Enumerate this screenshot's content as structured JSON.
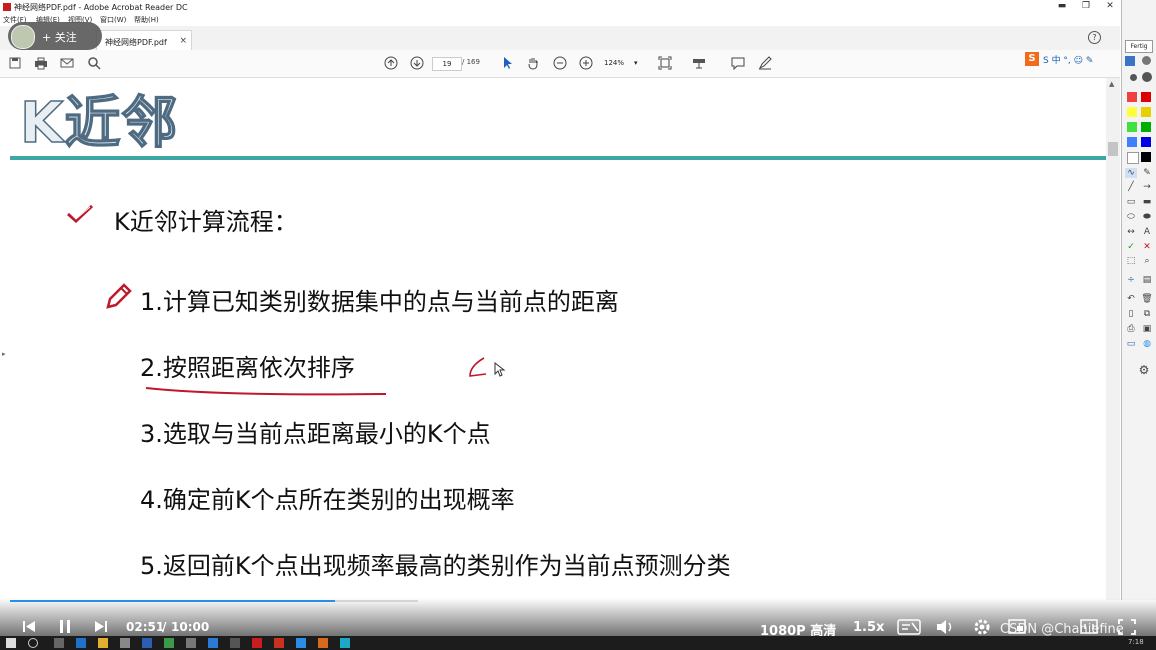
{
  "window": {
    "title": "神经网络PDF.pdf - Adobe Acrobat Reader DC",
    "minimize": "▬",
    "maximize": "❐",
    "close": "✕"
  },
  "menu": [
    "文件(F)",
    "编辑(E)",
    "视图(V)",
    "窗口(W)",
    "帮助(H)"
  ],
  "tab": {
    "label": "神经网络PDF.pdf",
    "close": "×"
  },
  "follow_button": "+ 关注",
  "toolbar": {
    "page_current": "19",
    "page_total": "/ 169",
    "zoom": "124%",
    "help": "?"
  },
  "sogou": "S 中 °, ☺ ✎",
  "document": {
    "title": "K近邻",
    "heading": "K近邻计算流程：",
    "steps": [
      "1.计算已知类别数据集中的点与当前点的距离",
      "2.按照距离依次排序",
      "3.选取与当前点距离最小的K个点",
      "4.确定前K个点所在类别的出现概率",
      "5.返回前K个点出现频率最高的类别作为当前点预测分类"
    ]
  },
  "palette": {
    "title": "Fertig",
    "colors": [
      "#f04040",
      "#dd0000",
      "#ffff40",
      "#e6d000",
      "#40e040",
      "#00b000",
      "#4080ff",
      "#0000e0",
      "#ffffff",
      "#000000"
    ]
  },
  "video": {
    "current_time": "02:51",
    "separator": "/",
    "duration": "10:00",
    "quality": "1080P 高清",
    "speed": "1.5x",
    "progress": 0.285,
    "watermark": "CSDN @Chaniefine"
  },
  "taskbar": {
    "clock": "7:18"
  }
}
